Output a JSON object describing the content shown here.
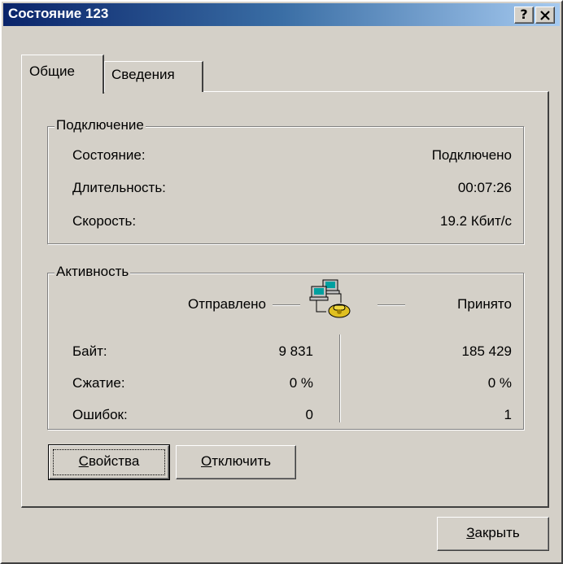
{
  "window": {
    "title": "Состояние 123",
    "help_label": "?",
    "close_label": "✕"
  },
  "tabs": [
    {
      "label": "Общие",
      "active": true
    },
    {
      "label": "Сведения",
      "active": false
    }
  ],
  "connection": {
    "legend": "Подключение",
    "rows": [
      {
        "label": "Состояние:",
        "value": "Подключено"
      },
      {
        "label": "Длительность:",
        "value": "00:07:26"
      },
      {
        "label": "Скорость:",
        "value": "19.2 Кбит/с"
      }
    ]
  },
  "activity": {
    "legend": "Активность",
    "sent_label": "Отправлено",
    "received_label": "Принято",
    "icon": "network-computers-phone-icon",
    "rows": [
      {
        "label": "Байт:",
        "sent": "9 831",
        "received": "185 429"
      },
      {
        "label": "Сжатие:",
        "sent": "0 %",
        "received": "0 %"
      },
      {
        "label": "Ошибок:",
        "sent": "0",
        "received": "1"
      }
    ]
  },
  "buttons": {
    "properties": {
      "hotkey": "С",
      "rest": "войства"
    },
    "disconnect": {
      "hotkey": "О",
      "rest": "тключить"
    },
    "close": {
      "hotkey": "З",
      "rest": "акрыть"
    }
  },
  "colors": {
    "face": "#d4d0c8",
    "title_start": "#0a246a",
    "title_end": "#a6caf0"
  }
}
